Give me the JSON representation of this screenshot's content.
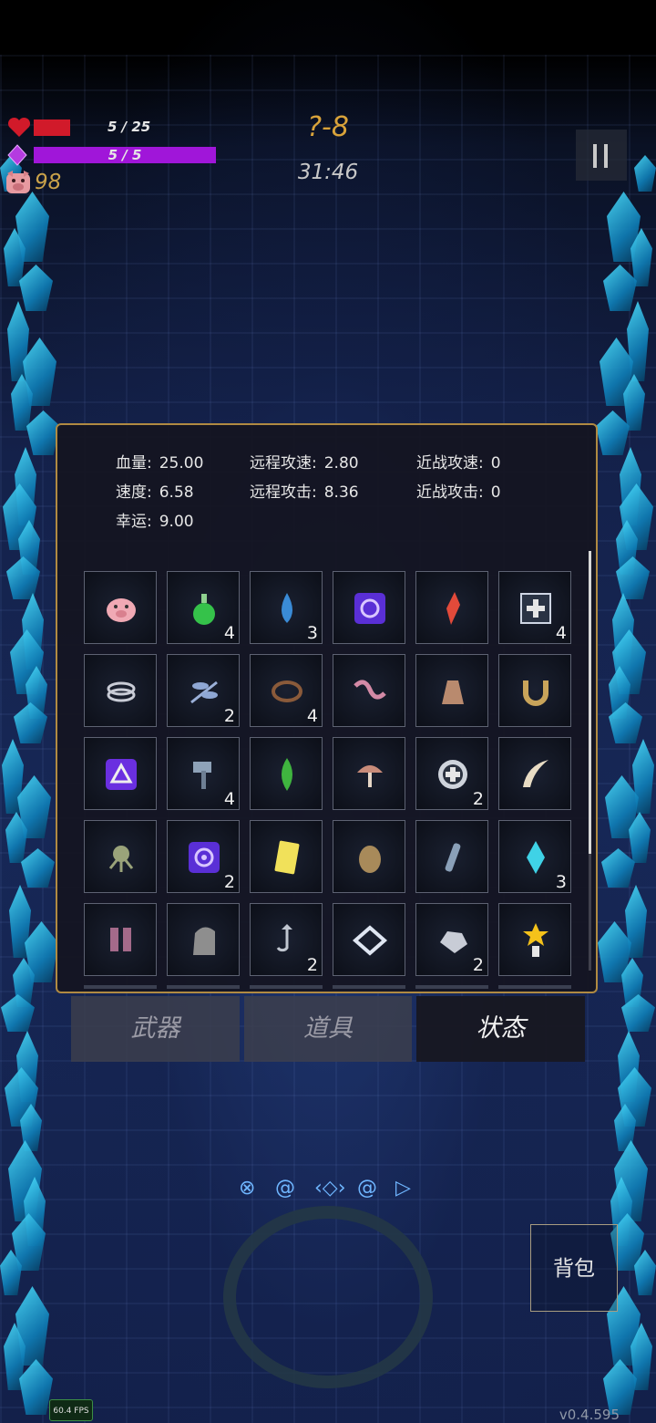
{
  "hud": {
    "hp_text": "5 / 25",
    "hp_fraction": 0.2,
    "mp_text": "5 / 5",
    "mp_fraction": 1.0,
    "coins": "98",
    "level": "?-8",
    "timer": "31:46",
    "icons": [
      "heart-icon",
      "purple-gem-icon",
      "pig-icon",
      "pause-icon"
    ]
  },
  "stats": [
    {
      "label": "血量:",
      "value": "25.00"
    },
    {
      "label": "远程攻速:",
      "value": "2.80"
    },
    {
      "label": "近战攻速:",
      "value": "0"
    },
    {
      "label": "速度:",
      "value": "6.58"
    },
    {
      "label": "远程攻击:",
      "value": "8.36"
    },
    {
      "label": "近战攻击:",
      "value": "0"
    },
    {
      "label": "幸运:",
      "value": "9.00"
    }
  ],
  "items": [
    {
      "icon": "piggy-bank-icon",
      "count": ""
    },
    {
      "icon": "green-potion-icon",
      "count": "4"
    },
    {
      "icon": "water-drop-icon",
      "count": "3"
    },
    {
      "icon": "purple-spiral-rune-icon",
      "count": ""
    },
    {
      "icon": "red-crystal-icon",
      "count": ""
    },
    {
      "icon": "health-plus-box-icon",
      "count": "4"
    },
    {
      "icon": "silver-rings-icon",
      "count": ""
    },
    {
      "icon": "dragonfly-icon",
      "count": "2"
    },
    {
      "icon": "thorn-wreath-icon",
      "count": "4"
    },
    {
      "icon": "worm-icon",
      "count": ""
    },
    {
      "icon": "pouch-icon",
      "count": ""
    },
    {
      "icon": "horseshoe-icon",
      "count": ""
    },
    {
      "icon": "purple-triangle-rune-icon",
      "count": ""
    },
    {
      "icon": "hammer-icon",
      "count": "4"
    },
    {
      "icon": "green-leaf-crystal-icon",
      "count": ""
    },
    {
      "icon": "mushroom-icon",
      "count": ""
    },
    {
      "icon": "cross-shield-ring-icon",
      "count": "2"
    },
    {
      "icon": "horn-icon",
      "count": ""
    },
    {
      "icon": "octopus-icon",
      "count": ""
    },
    {
      "icon": "purple-swirl-rune-icon",
      "count": "2"
    },
    {
      "icon": "yellow-card-icon",
      "count": ""
    },
    {
      "icon": "egg-icon",
      "count": ""
    },
    {
      "icon": "vial-icon",
      "count": ""
    },
    {
      "icon": "cyan-crystal-icon",
      "count": "3"
    },
    {
      "icon": "boots-icon",
      "count": ""
    },
    {
      "icon": "tombstone-icon",
      "count": ""
    },
    {
      "icon": "hook-icon",
      "count": "2"
    },
    {
      "icon": "diamond-frame-icon",
      "count": ""
    },
    {
      "icon": "silver-ore-icon",
      "count": "2"
    },
    {
      "icon": "star-trophy-icon",
      "count": ""
    }
  ],
  "tabs": [
    {
      "label": "武器",
      "active": false
    },
    {
      "label": "道具",
      "active": false
    },
    {
      "label": "状态",
      "active": true
    }
  ],
  "backpack_label": "背包",
  "fps": "60.4 FPS",
  "version": "v0.4.595",
  "colors": {
    "panel_border": "#b08a42",
    "hp": "#d11a2a",
    "mp": "#a016d9",
    "coin": "#c9a24a",
    "level": "#d9a33a"
  }
}
